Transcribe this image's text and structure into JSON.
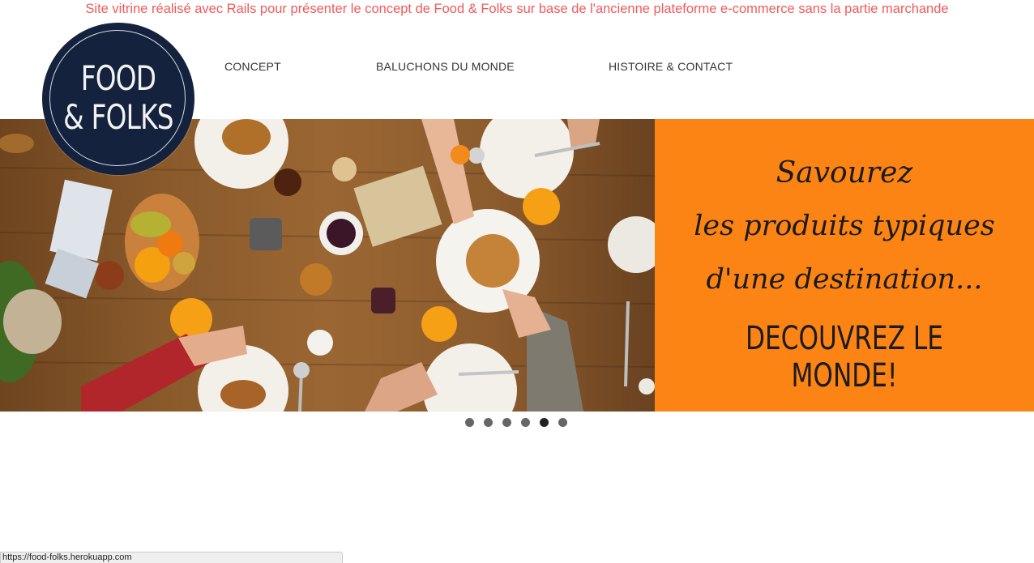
{
  "banner": {
    "text": "Site vitrine réalisé avec Rails pour présenter le concept de Food & Folks sur base de l'ancienne plateforme e-commerce sans la partie marchande"
  },
  "logo": {
    "line1": "FOOD",
    "line2": "& FOLKS"
  },
  "nav": {
    "items": [
      {
        "label": "CONCEPT"
      },
      {
        "label": "BALUCHONS DU MONDE"
      },
      {
        "label": "HISTOIRE & CONTACT"
      }
    ]
  },
  "hero": {
    "tagline_1": "Savourez",
    "tagline_2": "les produits typiques",
    "tagline_3": "d'une destination...",
    "tagline_4": "DECOUVREZ LE MONDE!",
    "photo_description_icon": "breakfast-table-photo",
    "panel_color": "#fc8414"
  },
  "carousel": {
    "slide_count": 6,
    "active_index": 4
  },
  "status_bar": {
    "url": "https://food-folks.herokuapp.com"
  },
  "colors": {
    "banner": "#f05a5a",
    "logo_bg": "#14223d",
    "accent_orange": "#fc8414"
  }
}
